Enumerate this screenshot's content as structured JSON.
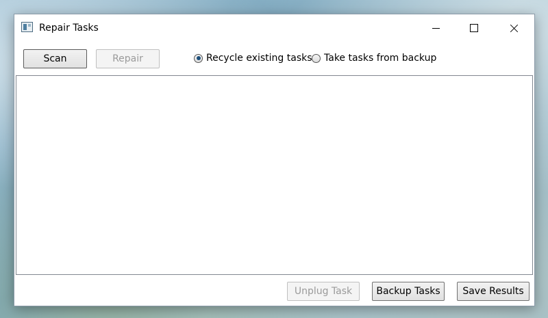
{
  "window": {
    "title": "Repair Tasks"
  },
  "toolbar": {
    "scan_label": "Scan",
    "repair_label": "Repair",
    "radio_recycle_label": "Recycle existing tasks",
    "radio_backup_label": "Take tasks from backup",
    "selected_option": "Recycle existing tasks"
  },
  "footer": {
    "unplug_label": "Unplug Task",
    "backup_label": "Backup Tasks",
    "save_label": "Save Results"
  },
  "colors": {
    "accent": "#1d4f7a",
    "disabled_text": "#9a9a9a",
    "border": "#707070"
  }
}
